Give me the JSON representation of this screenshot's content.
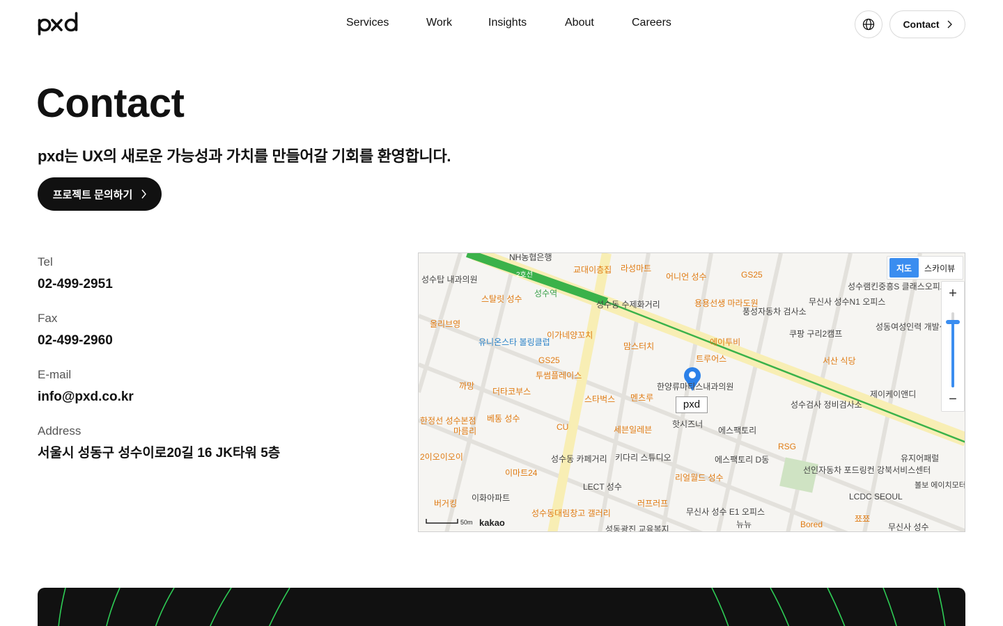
{
  "brand": {
    "logo_text": "pxd"
  },
  "nav": {
    "items": [
      "Services",
      "Work",
      "Insights",
      "About",
      "Careers"
    ],
    "contact_label": "Contact"
  },
  "hero": {
    "title": "Contact",
    "tagline": "pxd는 UX의 새로운 가능성과 가치를 만들어갈 기회를 환영합니다.",
    "cta_label": "프로젝트 문의하기"
  },
  "info": [
    {
      "label": "Tel",
      "value": "02-499-2951"
    },
    {
      "label": "Fax",
      "value": "02-499-2960"
    },
    {
      "label": "E-mail",
      "value": "info@pxd.co.kr"
    },
    {
      "label": "Address",
      "value": "서울시 성동구 성수이로20길 16 JK타워 5층"
    }
  ],
  "map": {
    "maptype_map": "지도",
    "maptype_sky": "스카이뷰",
    "zoom_in": "+",
    "zoom_out": "−",
    "pin_label": "pxd",
    "provider": "kakao",
    "scale": "50m",
    "labels": [
      "NH농협은행",
      "교대이층집",
      "라성마트",
      "어니언 성수",
      "GS25",
      "성수탑 내과의원",
      "2호선",
      "스탈릿 성수",
      "성수역",
      "성수동 수제화거리",
      "용용선생 마라도원",
      "풍성자동차 검사소",
      "무신사 성수N1 오피스",
      "성수램킨중흥S 클래스오피스텔",
      "올리브영",
      "이가네양꼬치",
      "유니온스타 볼링클럽",
      "맘스터치",
      "에이투비",
      "쿠팡 구리2캠프",
      "서산 식당",
      "성동여성인력 개발센터",
      "GS25",
      "트루어스",
      "투썸플레이스",
      "까망",
      "더타코부스",
      "스타벅스",
      "멘츠루",
      "한양류마티스내과의원",
      "제이케이앤디",
      "베통 성수",
      "한정선 성수본점",
      "마름리",
      "CU",
      "세븐일레븐",
      "핫시즈너",
      "에스팩토리",
      "성수검사 정비검사소",
      "이마트24",
      "성수동 카페거리",
      "키다리 스튜디오",
      "에스팩토리 D동",
      "RSG",
      "유지어패럴",
      "선인자동차 포드링컨 강북서비스센터",
      "2이오이오이",
      "버거킹",
      "이화아파트",
      "LECT 성수",
      "리얼월드 성수",
      "러프러프",
      "무신사 성수 E1 오피스",
      "뉴뉴",
      "Bored",
      "LCDC SEOUL",
      "볼보 에이치모터스 성수 서비스센터",
      "성수동대림창고 갤러리",
      "쬬쬬",
      "무신사 성수",
      "성동광진 교육복지"
    ]
  },
  "colors": {
    "accent_dark": "#111111",
    "map_blue": "#3a8df0",
    "subway_green": "#3bb24a",
    "poi_orange": "#e07b13"
  }
}
